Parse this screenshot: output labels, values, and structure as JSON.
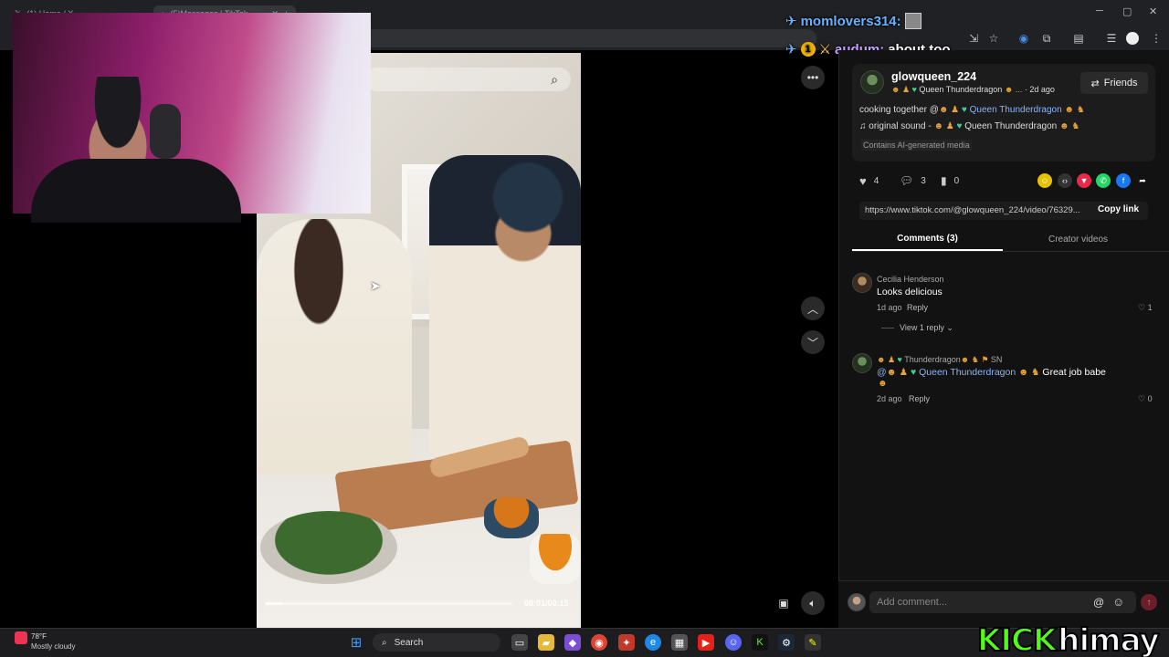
{
  "browser": {
    "tabs": [
      {
        "label": "(1) Home / X",
        "icon": "x-logo-icon"
      },
      {
        "label": "(5)Messages | TikTok",
        "icon": "tiktok-icon"
      }
    ]
  },
  "stream_chat": [
    {
      "user": "momlovers314:",
      "message": "",
      "user_color": "#6ab0ff"
    },
    {
      "user": "audum:",
      "message": "about too",
      "user_color": "#c7a0ff"
    }
  ],
  "video": {
    "time": "00:01/00:15",
    "progress_fraction": 0.067
  },
  "post": {
    "username": "glowqueen_224",
    "display_name": "Queen Thunderdragon",
    "age": "· 2d ago",
    "friends_label": "Friends",
    "caption_prefix": "cooking together @",
    "caption_mention": "Queen Thunderdragon",
    "sound_label": "original sound -",
    "sound_author": "Queen Thunderdragon",
    "ai_label": "Contains AI-generated media",
    "likes": "4",
    "comments": "3",
    "saves": "0",
    "url": "https://www.tiktok.com/@glowqueen_224/video/76329...",
    "copy_link": "Copy link"
  },
  "tabs": {
    "comments": "Comments (3)",
    "creator": "Creator videos"
  },
  "comments": [
    {
      "name": "Cecilia Henderson",
      "text": "Looks delicious",
      "age": "1d ago",
      "reply": "Reply",
      "likes": "1",
      "view_replies": "View 1 reply"
    },
    {
      "name": "Thunderdragon",
      "name_suffix": "SN",
      "mention": "Queen Thunderdragon",
      "text": "Great job babe",
      "age": "2d ago",
      "reply": "Reply",
      "likes": "0"
    }
  ],
  "comment_input": {
    "placeholder": "Add comment..."
  },
  "taskbar": {
    "weather_temp": "78°F",
    "weather_desc": "Mostly cloudy",
    "search": "Search"
  },
  "overlay": {
    "kick_word": "KICK",
    "kick_user": "himay",
    "kick_color": "#53fc18"
  }
}
